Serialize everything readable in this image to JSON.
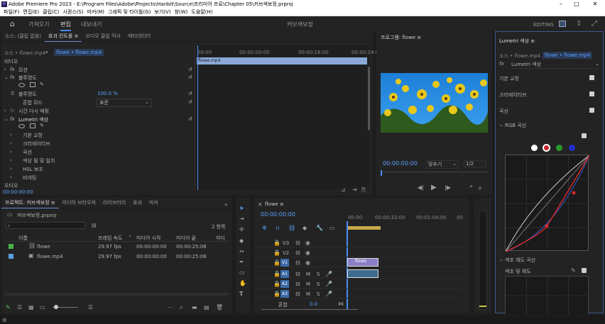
{
  "app": {
    "title": "Adobe Premiere Pro 2023 - E:\\Program Files\\Adobe\\Projects\\Hanbit\\Source\\프리미어 프로\\Chapter 05\\커브색보정.prproj"
  },
  "menu": [
    "파일(F)",
    "편집(E)",
    "클립(C)",
    "시퀀스(S)",
    "마커(M)",
    "그래픽 및 타이틀(G)",
    "보기(V)",
    "창(W)",
    "도움말(H)"
  ],
  "workspaces": {
    "items": [
      "가져오기",
      "편집",
      "내보내기"
    ],
    "active": "편집",
    "project_name": "커브색보정",
    "editing": "EDITING"
  },
  "effect_controls": {
    "tabs": [
      "소스: (클립 없음)",
      "효과 컨트롤 ≡",
      "오디오 클립 믹서",
      "메타데이터"
    ],
    "source_clip": "소스 • flowe.mp4",
    "seq_clip": "flowe • flowe.mp4",
    "video_label": "비디오",
    "motion": "모션",
    "opacity": "불투명도",
    "opacity_param": "불투명도",
    "opacity_value": "100.0 %",
    "blend_label": "혼합 모드",
    "blend_value": "표준",
    "time_remap": "시간 다시 매핑",
    "lumetri": "Lumetri 색상",
    "sub": [
      "기본 교정",
      "크리에이티브",
      "곡선",
      "색상 휠 및 일치",
      "HSL 보조",
      "비네팅"
    ],
    "audio_label": "오디오",
    "timecode": "00:00:00:00",
    "ruler": [
      "00:00",
      "00:00:00:00",
      "00:00:16:00",
      "00:00:24:0"
    ],
    "clip_name": "flowe.mp4"
  },
  "program": {
    "title": "프로그램: flowe ≡",
    "timecode": "00:00:00:00",
    "fit": "맞추기",
    "quality": "1/2"
  },
  "project": {
    "tabs": [
      "프로젝트: 커브색보정 ≡",
      "미디어 브라우저",
      "라이브러리",
      "효과",
      "마커"
    ],
    "file": "커브색보정.prproj",
    "count": "2 항목",
    "headers": [
      "이름",
      "프레임 속도",
      "미디어 시작",
      "미디어 끝",
      "미디"
    ],
    "rows": [
      {
        "color": "#47b347",
        "name": "flowe",
        "fps": "29.97 fps",
        "start": "00:00:00:00",
        "end": "00:00:25:06"
      },
      {
        "color": "#5a9ee0",
        "name": "flowe.mp4",
        "fps": "29.97 fps",
        "start": "00:00:00:00",
        "end": "00:00:25:06"
      }
    ]
  },
  "timeline": {
    "tab": "flowe ≡",
    "timecode": "00:00:00:00",
    "ruler": [
      "00:00",
      "00:00:32:00",
      "00:01:04:00",
      "00"
    ],
    "video_tracks": [
      "V3",
      "V2",
      "V1"
    ],
    "audio_tracks": [
      "A1",
      "A2",
      "A3"
    ],
    "mix": "혼합",
    "mix_value": "0.0",
    "clip_label": "flowe"
  },
  "lumetri": {
    "title": "Lumetri 색상 ≡",
    "source": "소스 • flowe.mp4",
    "seq": "flowe • flowe.mp4",
    "fx_name": "Lumetri 색상",
    "sections": [
      "기본 교정",
      "크리에이티브",
      "곡선"
    ],
    "rgb_label": "RGB 곡선",
    "hue_label": "색조 채도 곡선",
    "hue_sat": "색조 및 채도"
  }
}
